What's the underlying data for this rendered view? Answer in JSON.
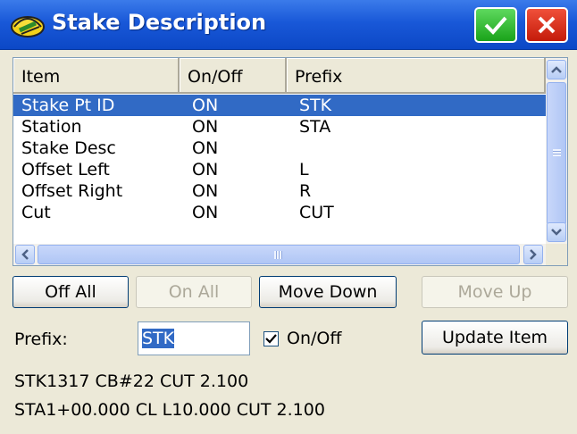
{
  "window": {
    "title": "Stake Description"
  },
  "list": {
    "columns": [
      "Item",
      "On/Off",
      "Prefix"
    ],
    "rows": [
      {
        "item": "Stake Pt ID",
        "state": "ON",
        "prefix": "STK",
        "selected": true
      },
      {
        "item": "Station",
        "state": "ON",
        "prefix": "STA",
        "selected": false
      },
      {
        "item": "Stake Desc",
        "state": "ON",
        "prefix": "",
        "selected": false
      },
      {
        "item": "Offset Left",
        "state": "ON",
        "prefix": "L",
        "selected": false
      },
      {
        "item": "Offset Right",
        "state": "ON",
        "prefix": "R",
        "selected": false
      },
      {
        "item": "Cut",
        "state": "ON",
        "prefix": "CUT",
        "selected": false
      }
    ]
  },
  "buttons": {
    "off_all": "Off All",
    "on_all": "On All",
    "move_down": "Move Down",
    "move_up": "Move Up",
    "update_item": "Update Item"
  },
  "prefix_label": "Prefix:",
  "prefix_value": "STK",
  "onoff": {
    "label": "On/Off",
    "checked": true
  },
  "preview": {
    "line1": "STK1317 CB#22 CUT 2.100",
    "line2": "STA1+00.000 CL L10.000 CUT 2.100"
  },
  "colors": {
    "titlebar": "#1958d8",
    "selection": "#316ac5",
    "ok": "#1aa31a",
    "close": "#c41b0a"
  }
}
